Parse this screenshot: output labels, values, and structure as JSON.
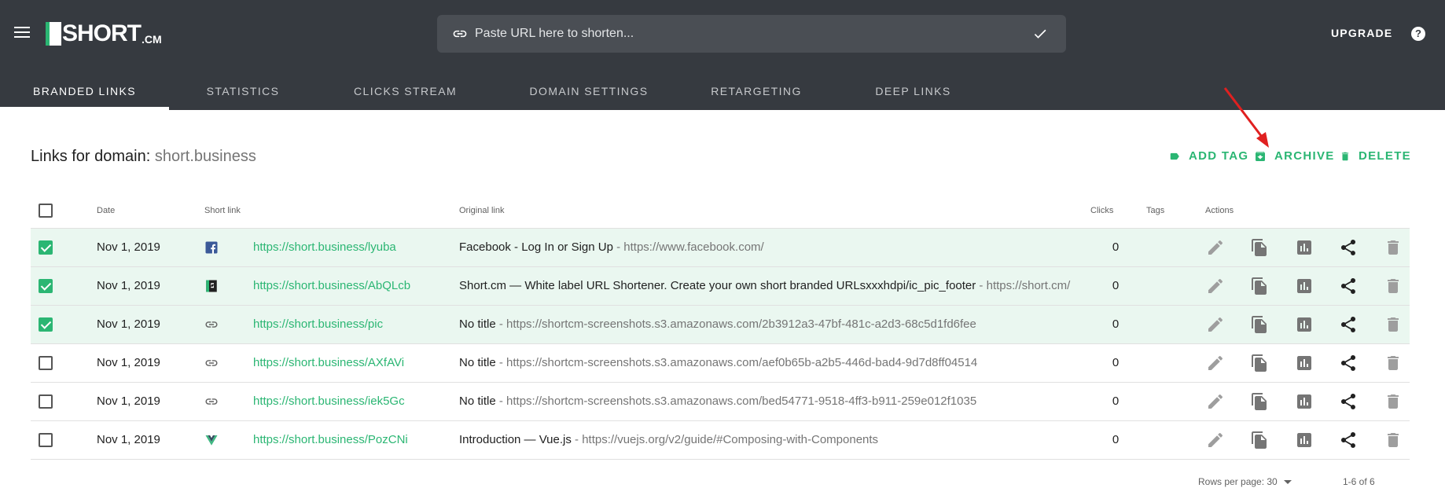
{
  "app": {
    "logo_text": "SHORT",
    "logo_suffix": ".CM",
    "url_placeholder": "Paste URL here to shorten...",
    "upgrade_label": "UPGRADE",
    "help_label": "?"
  },
  "tabs": [
    {
      "label": "BRANDED LINKS",
      "active": true
    },
    {
      "label": "STATISTICS",
      "active": false
    },
    {
      "label": "CLICKS STREAM",
      "active": false
    },
    {
      "label": "DOMAIN SETTINGS",
      "active": false
    },
    {
      "label": "RETARGETING",
      "active": false
    },
    {
      "label": "DEEP LINKS",
      "active": false
    }
  ],
  "header": {
    "title_prefix": "Links for domain:",
    "domain": "short.business",
    "actions": [
      {
        "label": "ADD TAG",
        "icon": "tag-icon"
      },
      {
        "label": "ARCHIVE",
        "icon": "archive-icon"
      },
      {
        "label": "DELETE",
        "icon": "trash-icon"
      }
    ]
  },
  "table": {
    "columns": {
      "date": "Date",
      "short_link": "Short link",
      "original_link": "Original link",
      "clicks": "Clicks",
      "tags": "Tags",
      "actions": "Actions"
    },
    "rows": [
      {
        "checked": true,
        "date": "Nov 1, 2019",
        "favicon": "facebook-icon",
        "short": "https://short.business/lyuba",
        "title": "Facebook - Log In or Sign Up",
        "url": " - https://www.facebook.com/",
        "clicks": "0"
      },
      {
        "checked": true,
        "date": "Nov 1, 2019",
        "favicon": "shortcm-icon",
        "short": "https://short.business/AbQLcb",
        "title": "Short.cm — White label URL Shortener. Create your own short branded URLsxxxhdpi/ic_pic_footer",
        "url": " - https://short.cm/",
        "clicks": "0"
      },
      {
        "checked": true,
        "date": "Nov 1, 2019",
        "favicon": "link-icon",
        "short": "https://short.business/pic",
        "title": "No title",
        "url": " - https://shortcm-screenshots.s3.amazonaws.com/2b3912a3-47bf-481c-a2d3-68c5d1fd6fee",
        "clicks": "0"
      },
      {
        "checked": false,
        "date": "Nov 1, 2019",
        "favicon": "link-icon",
        "short": "https://short.business/AXfAVi",
        "title": "No title",
        "url": " - https://shortcm-screenshots.s3.amazonaws.com/aef0b65b-a2b5-446d-bad4-9d7d8ff04514",
        "clicks": "0"
      },
      {
        "checked": false,
        "date": "Nov 1, 2019",
        "favicon": "link-icon",
        "short": "https://short.business/iek5Gc",
        "title": "No title",
        "url": " - https://shortcm-screenshots.s3.amazonaws.com/bed54771-9518-4ff3-b911-259e012f1035",
        "clicks": "0"
      },
      {
        "checked": false,
        "date": "Nov 1, 2019",
        "favicon": "vue-icon",
        "short": "https://short.business/PozCNi",
        "title": "Introduction — Vue.js",
        "url": " - https://vuejs.org/v2/guide/#Composing-with-Components",
        "clicks": "0"
      }
    ]
  },
  "footer": {
    "rows_per_page_label": "Rows per page: 30",
    "range": "1-6 of 6"
  },
  "colors": {
    "topbar": "#363a40",
    "accent": "#2bb673",
    "selected_row": "#eaf7f0",
    "annotation": "#e02020"
  }
}
